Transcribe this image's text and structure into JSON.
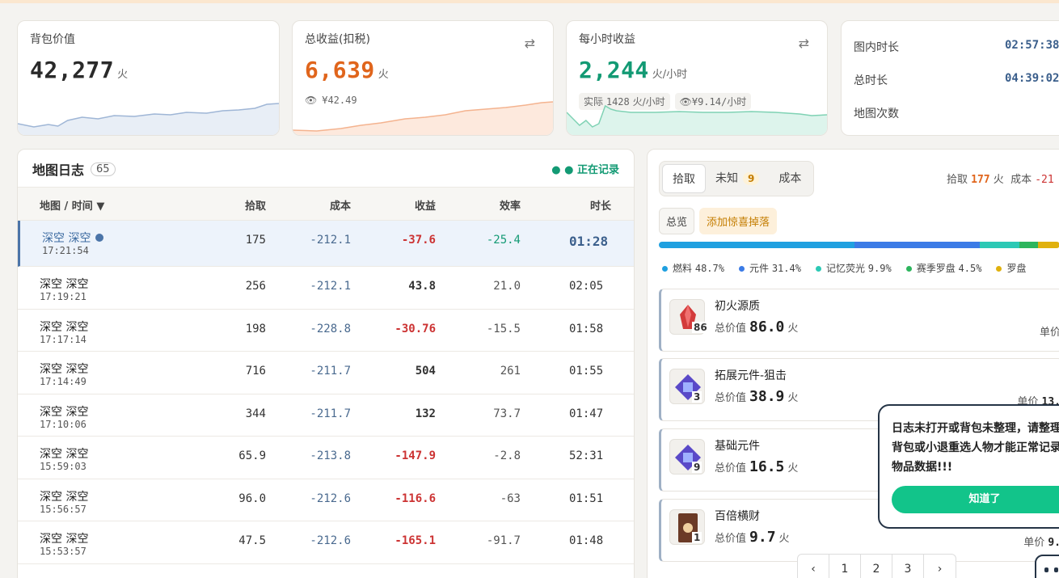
{
  "stats": {
    "backpack": {
      "title": "背包价值",
      "value": "42,277",
      "unit": "火"
    },
    "total": {
      "title": "总收益(扣税)",
      "value": "6,639",
      "unit": "火",
      "sub": "¥42.49",
      "color": "#e0651c"
    },
    "hourly": {
      "title": "每小时收益",
      "value": "2,244",
      "unit": "火/小时",
      "actual_label": "实际",
      "actual_value": "1428",
      "actual_unit": "火/小时",
      "cny": "¥9.14/小时",
      "color": "#139a74"
    },
    "times": [
      {
        "label": "图内时长",
        "value": "02:57:38"
      },
      {
        "label": "总时长",
        "value": "04:39:02"
      },
      {
        "label": "地图次数",
        "value": ""
      }
    ]
  },
  "map_log": {
    "title": "地图日志",
    "count": "65",
    "recording": "● 正在记录",
    "columns": [
      "地图 / 时间 ▼",
      "拾取",
      "成本",
      "收益",
      "效率",
      "时长"
    ],
    "rows": [
      {
        "name": "深空 深空",
        "time": "17:21:54",
        "pickup": "175",
        "cost": "-212.1",
        "profit": "-37.6",
        "eff": "-25.4",
        "dur": "01:28",
        "neg": true,
        "selected": true
      },
      {
        "name": "深空 深空",
        "time": "17:19:21",
        "pickup": "256",
        "cost": "-212.1",
        "profit": "43.8",
        "eff": "21.0",
        "dur": "02:05",
        "neg": false
      },
      {
        "name": "深空 深空",
        "time": "17:17:14",
        "pickup": "198",
        "cost": "-228.8",
        "profit": "-30.76",
        "eff": "-15.5",
        "dur": "01:58",
        "neg": true
      },
      {
        "name": "深空 深空",
        "time": "17:14:49",
        "pickup": "716",
        "cost": "-211.7",
        "profit": "504",
        "eff": "261",
        "dur": "01:55",
        "neg": false
      },
      {
        "name": "深空 深空",
        "time": "17:10:06",
        "pickup": "344",
        "cost": "-211.7",
        "profit": "132",
        "eff": "73.7",
        "dur": "01:47",
        "neg": false
      },
      {
        "name": "深空 深空",
        "time": "15:59:03",
        "pickup": "65.9",
        "cost": "-213.8",
        "profit": "-147.9",
        "eff": "-2.8",
        "dur": "52:31",
        "neg": true
      },
      {
        "name": "深空 深空",
        "time": "15:56:57",
        "pickup": "96.0",
        "cost": "-212.6",
        "profit": "-116.6",
        "eff": "-63",
        "dur": "01:51",
        "neg": true
      },
      {
        "name": "深空 深空",
        "time": "15:53:57",
        "pickup": "47.5",
        "cost": "-212.6",
        "profit": "-165.1",
        "eff": "-91.7",
        "dur": "01:48",
        "neg": true
      }
    ]
  },
  "detail": {
    "tabs": [
      {
        "label": "拾取",
        "badge": ""
      },
      {
        "label": "未知",
        "badge": "9"
      },
      {
        "label": "成本",
        "badge": ""
      }
    ],
    "summary": {
      "pickup_label": "拾取",
      "pickup_value": "177",
      "unit": "火",
      "cost_label": "成本",
      "cost_value": "-21"
    },
    "subtabs": [
      "总览",
      "添加惊喜掉落"
    ],
    "breakdown": [
      {
        "label": "燃料",
        "pct": "48.7%",
        "value": 48.7,
        "color": "#1fa0e0"
      },
      {
        "label": "元件",
        "pct": "31.4%",
        "value": 31.4,
        "color": "#3b7be6"
      },
      {
        "label": "记忆荧光",
        "pct": "9.9%",
        "value": 9.9,
        "color": "#2cc9b5"
      },
      {
        "label": "赛季罗盘",
        "pct": "4.5%",
        "value": 4.5,
        "color": "#2db55d"
      },
      {
        "label": "罗盘",
        "pct": "",
        "value": 5.5,
        "color": "#e0b10e"
      }
    ],
    "items": [
      {
        "name": "初火源质",
        "qty": "86",
        "total_label": "总价值",
        "total": "86.0",
        "unit": "火",
        "unit_label": "单价",
        "unit_price": "",
        "icon": "red-crystal-icon",
        "color": "#d33b3b"
      },
      {
        "name": "拓展元件-狙击",
        "qty": "3",
        "total_label": "总价值",
        "total": "38.9",
        "unit": "火",
        "unit_label": "单价",
        "unit_price": "13.",
        "icon": "chip-icon",
        "color": "#5a49c8"
      },
      {
        "name": "基础元件",
        "qty": "9",
        "total_label": "总价值",
        "total": "16.5",
        "unit": "火",
        "unit_label": "",
        "unit_price": "",
        "icon": "chip-icon",
        "color": "#5a49c8"
      },
      {
        "name": "百倍横财",
        "qty": "1",
        "total_label": "总价值",
        "total": "9.7",
        "unit": "火",
        "unit_label": "单价",
        "unit_price": "9.",
        "icon": "card-icon",
        "color": "#6b3a26"
      }
    ],
    "pagination": [
      "‹",
      "1",
      "2",
      "3",
      "›"
    ]
  },
  "tooltip": {
    "text": "日志未打开或背包未整理，请整理背包或小退重选人物才能正常记录物品数据!!!",
    "button": "知道了"
  }
}
